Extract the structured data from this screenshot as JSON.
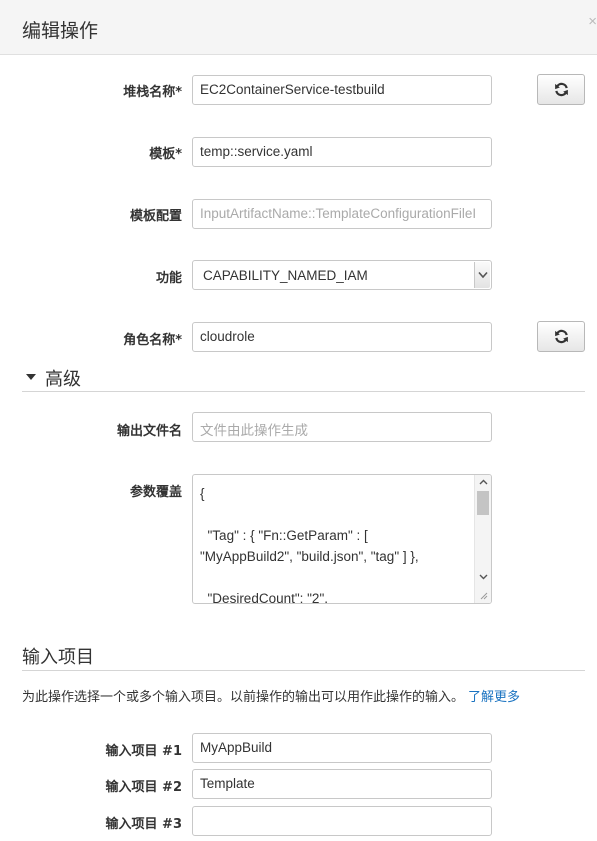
{
  "header": {
    "title": "编辑操作",
    "close_icon": "×"
  },
  "fields": {
    "stack_name": {
      "label": "堆栈名称*",
      "value": "EC2ContainerService-testbuild"
    },
    "template": {
      "label": "模板*",
      "value": "temp::service.yaml"
    },
    "template_config": {
      "label": "模板配置",
      "placeholder": "InputArtifactName::TemplateConfigurationFileI"
    },
    "capabilities": {
      "label": "功能",
      "value": "CAPABILITY_NAMED_IAM"
    },
    "role_name": {
      "label": "角色名称*",
      "value": "cloudrole"
    }
  },
  "advanced": {
    "heading": "高级",
    "output_file": {
      "label": "输出文件名",
      "placeholder": "文件由此操作生成"
    },
    "param_override": {
      "label": "参数覆盖",
      "value": "{\n\n  \"Tag\" : { \"Fn::GetParam\" : [\n\"MyAppBuild2\", \"build.json\", \"tag\" ] },\n\n  \"DesiredCount\": \"2\","
    }
  },
  "input_artifacts": {
    "heading": "输入项目",
    "description": "为此操作选择一个或多个输入项目。以前操作的输出可以用作此操作的输入。",
    "learn_more": "了解更多",
    "items": [
      {
        "label": "输入项目 #1",
        "value": "MyAppBuild"
      },
      {
        "label": "输入项目 #2",
        "value": "Template"
      },
      {
        "label": "输入项目 #3",
        "value": ""
      }
    ]
  },
  "icons": {
    "refresh": "refresh-icon",
    "caret": "caret-down-icon"
  }
}
